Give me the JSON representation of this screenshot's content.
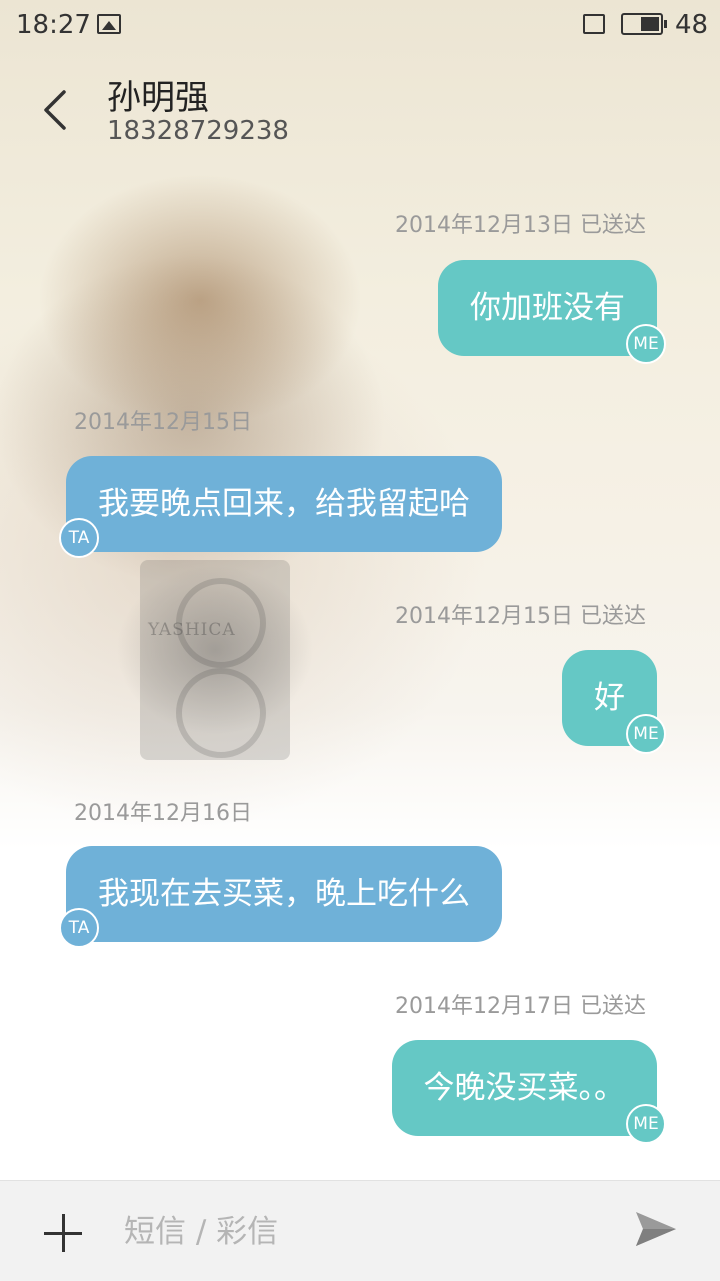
{
  "status_bar": {
    "time": "18:27",
    "battery": "48"
  },
  "header": {
    "name": "孙明强",
    "number": "18328729238"
  },
  "background": {
    "camera_brand": "YASHICA"
  },
  "messages": [
    {
      "from": "me",
      "meta": "2014年12月13日  已送达",
      "text": "你加班没有",
      "avatar": "ME"
    },
    {
      "from": "ta",
      "meta": "2014年12月15日",
      "text": "我要晚点回来，给我留起哈",
      "avatar": "TA"
    },
    {
      "from": "me",
      "meta": "2014年12月15日  已送达",
      "text": "好",
      "avatar": "ME"
    },
    {
      "from": "ta",
      "meta": "2014年12月16日",
      "text": "我现在去买菜，晚上吃什么",
      "avatar": "TA"
    },
    {
      "from": "me",
      "meta": "2014年12月17日  已送达",
      "text": "今晚没买菜。。",
      "avatar": "ME"
    }
  ],
  "input": {
    "placeholder": "短信 / 彩信",
    "value": ""
  },
  "colors": {
    "me_bubble": "#65c8c5",
    "ta_bubble": "#6fb1d8"
  },
  "icons": {
    "back": "chevron-left-icon",
    "attach": "plus-icon",
    "send": "send-icon",
    "gallery": "picture-icon",
    "sim": "sim-card-icon",
    "battery": "battery-icon"
  }
}
